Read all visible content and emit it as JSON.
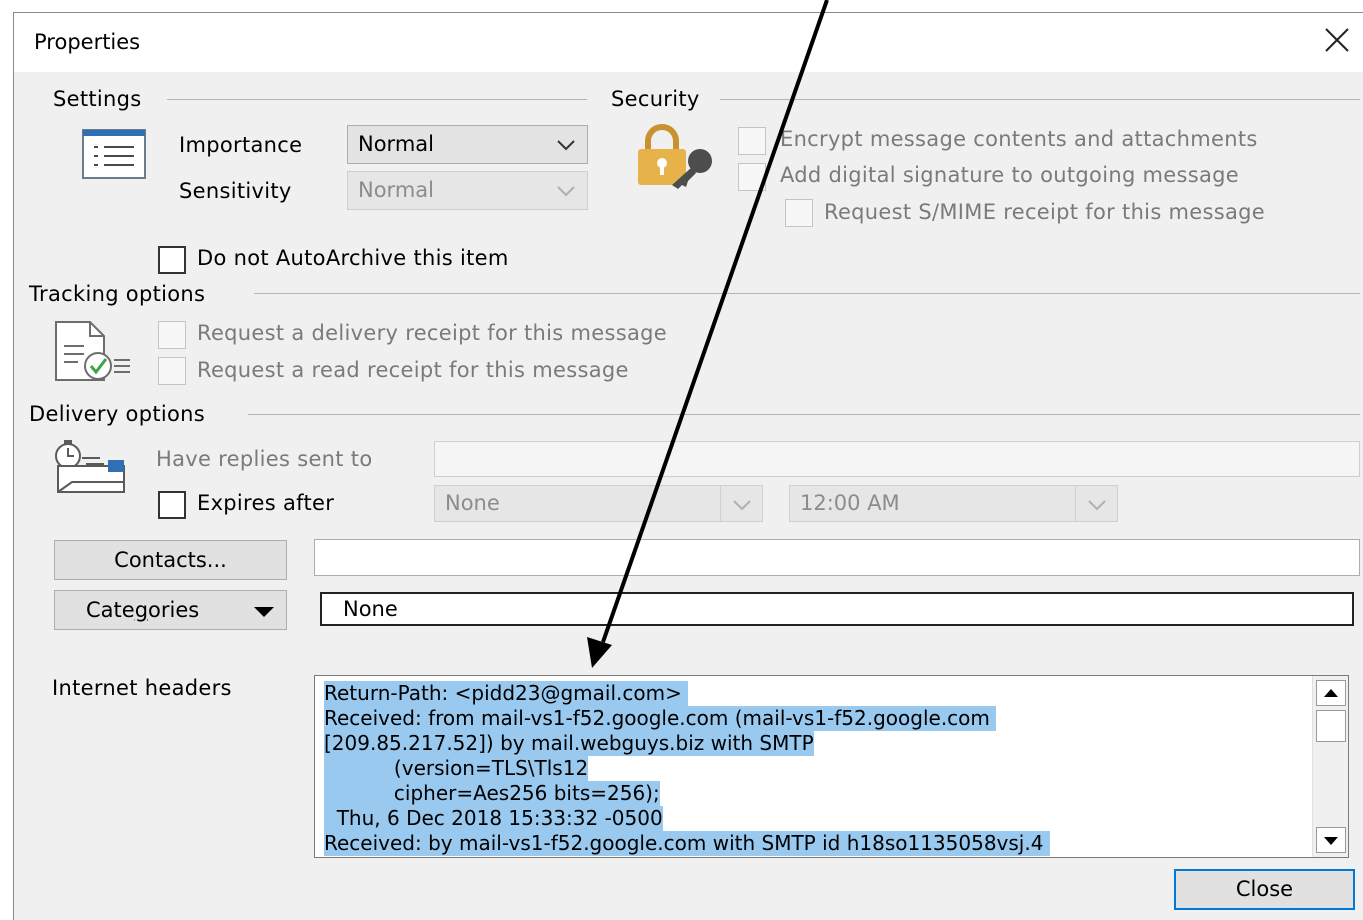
{
  "dialog": {
    "title": "Properties"
  },
  "settings": {
    "group_label": "Settings",
    "importance_label": "Importance",
    "importance_value": "Normal",
    "sensitivity_label": "Sensitivity",
    "sensitivity_value": "Normal",
    "autoarchive_label": "Do not AutoArchive this item"
  },
  "security": {
    "group_label": "Security",
    "encrypt_label": "Encrypt message contents and attachments",
    "signature_label": "Add digital signature to outgoing message",
    "smime_label": "Request S/MIME receipt for this message"
  },
  "tracking": {
    "group_label": "Tracking options",
    "delivery_receipt_label": "Request a delivery receipt for this message",
    "read_receipt_label": "Request a read receipt for this message"
  },
  "delivery": {
    "group_label": "Delivery options",
    "replies_label": "Have replies sent to",
    "replies_value": "",
    "expires_label": "Expires after",
    "expires_date": "None",
    "expires_time": "12:00 AM"
  },
  "contacts": {
    "button_label": "Contacts...",
    "value": ""
  },
  "categories": {
    "button_prefix": "Cate",
    "button_mnemonic": "g",
    "button_suffix": "ories",
    "value": "None"
  },
  "internet_headers": {
    "label": "Internet headers",
    "lines": [
      "Return-Path: <pidd23@gmail.com> ",
      "Received: from mail-vs1-f52.google.com (mail-vs1-f52.google.com ",
      "[209.85.217.52]) by mail.webguys.biz with SMTP",
      "           (version=TLS\\Tls12",
      "           cipher=Aes256 bits=256);",
      "  Thu, 6 Dec 2018 15:33:32 -0500",
      "Received: by mail-vs1-f52.google.com with SMTP id h18so1135058vsj.4 "
    ]
  },
  "footer": {
    "close_label": "Close"
  },
  "colors": {
    "dialog_bg": "#f0f0f0",
    "selection": "#99c9ef",
    "accent_border": "#0078d7",
    "lock_gold": "#e8b24a"
  }
}
